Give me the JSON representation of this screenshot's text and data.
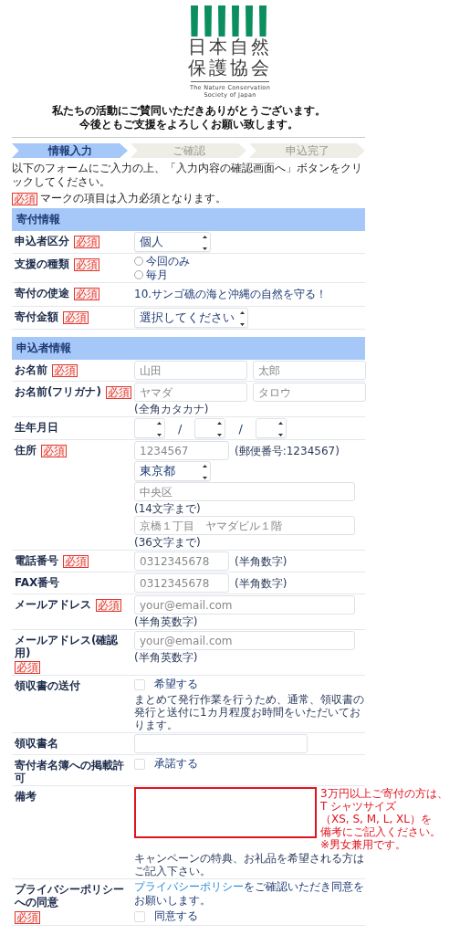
{
  "logo": {
    "title_lines": [
      "日本自然",
      "保護協会"
    ],
    "subtitle_lines": [
      "The Nature Conservation",
      "Society of Japan"
    ]
  },
  "greeting": [
    "私たちの活動にご賛同いただきありがとうございます。",
    "今後ともご支援をよろしくお願い致します。"
  ],
  "steps": [
    {
      "label": "情報入力",
      "selected": true
    },
    {
      "label": "ご確認",
      "selected": false
    },
    {
      "label": "申込完了",
      "selected": false
    }
  ],
  "instruction": "以下のフォームにご入力の上、「入力内容の確認画面へ」ボタンをクリックしてください。",
  "required_note": {
    "badge": "必須",
    "text": "マークの項目は入力必須となります。"
  },
  "sections": [
    {
      "title": "寄付情報",
      "fields": [
        {
          "label": "申込者区分",
          "required_badge": "必須",
          "lines": [
            [
              {
                "kind": "select",
                "value": "個人"
              }
            ]
          ]
        },
        {
          "label": "支援の種類",
          "required_badge": "必須",
          "lines": [
            [
              {
                "kind": "radio",
                "label": "今回のみ",
                "selected": false
              }
            ],
            [
              {
                "kind": "radio",
                "label": "毎月",
                "selected": false
              }
            ]
          ]
        },
        {
          "label": "寄付の使途",
          "required_badge": "必須",
          "lines": [
            [
              {
                "kind": "text",
                "text": "10.サンゴ礁の海と沖縄の自然を守る！"
              }
            ]
          ]
        },
        {
          "label": "寄付金額",
          "required_badge": "必須",
          "lines": [
            [
              {
                "kind": "select",
                "value": "選択してください"
              }
            ]
          ]
        }
      ]
    },
    {
      "title": "申込者情報",
      "fields": [
        {
          "label": "お名前",
          "required_badge": "必須",
          "lines": [
            [
              {
                "kind": "input",
                "placeholder": "山田"
              },
              {
                "kind": "input",
                "placeholder": "太郎"
              }
            ]
          ]
        },
        {
          "label": "お名前(フリガナ)",
          "required_badge": "必須",
          "lines": [
            [
              {
                "kind": "input",
                "placeholder": "ヤマダ"
              },
              {
                "kind": "input",
                "placeholder": "タロウ"
              }
            ],
            [
              {
                "kind": "hint",
                "text": "(全角カタカナ)"
              }
            ]
          ]
        },
        {
          "label": "生年月日",
          "lines": [
            [
              {
                "kind": "select"
              },
              {
                "kind": "separator",
                "text": "/"
              },
              {
                "kind": "select"
              },
              {
                "kind": "separator",
                "text": "/"
              },
              {
                "kind": "select"
              }
            ]
          ]
        },
        {
          "label": "住所",
          "required_badge": "必須",
          "lines": [
            [
              {
                "kind": "input",
                "placeholder": "1234567"
              },
              {
                "kind": "hint",
                "text": "(郵便番号:1234567)"
              }
            ],
            [
              {
                "kind": "select",
                "value": "東京都"
              }
            ],
            [
              {
                "kind": "input",
                "placeholder": "中央区"
              }
            ],
            [
              {
                "kind": "hint",
                "text": "(14文字まで)"
              }
            ],
            [
              {
                "kind": "input",
                "placeholder": "京橋１丁目　ヤマダビル１階"
              }
            ],
            [
              {
                "kind": "hint",
                "text": "(36文字まで)"
              }
            ]
          ]
        },
        {
          "label": "電話番号",
          "required_badge": "必須",
          "lines": [
            [
              {
                "kind": "input",
                "placeholder": "0312345678"
              },
              {
                "kind": "hint",
                "text": "(半角数字)"
              }
            ]
          ]
        },
        {
          "label": "FAX番号",
          "lines": [
            [
              {
                "kind": "input",
                "placeholder": "0312345678"
              },
              {
                "kind": "hint",
                "text": "(半角数字)"
              }
            ]
          ]
        },
        {
          "label": "メールアドレス",
          "required_badge": "必須",
          "lines": [
            [
              {
                "kind": "input",
                "placeholder": "your@email.com"
              }
            ],
            [
              {
                "kind": "hint",
                "text": "(半角英数字)"
              }
            ]
          ]
        },
        {
          "label": "メールアドレス(確認用)",
          "required_badge": "必須",
          "lines": [
            [
              {
                "kind": "input",
                "placeholder": "your@email.com"
              }
            ],
            [
              {
                "kind": "hint",
                "text": "(半角英数字)"
              }
            ]
          ]
        },
        {
          "label": "領収書の送付",
          "lines": [
            [
              {
                "kind": "checkbox",
                "label": "希望する",
                "checked": false
              }
            ],
            [
              {
                "kind": "hint",
                "text": "まとめて発行作業を行うため、通常、領収書の発行と送付に1カ月程度お時間をいただいております。"
              }
            ]
          ]
        },
        {
          "label": "領収書名",
          "lines": [
            [
              {
                "kind": "input"
              }
            ]
          ]
        },
        {
          "label": "寄付者名簿への掲載許可",
          "lines": [
            [
              {
                "kind": "checkbox",
                "label": "承諾する",
                "checked": false
              }
            ]
          ]
        },
        {
          "label": "備考",
          "side_note": [
            "3万円以上ご寄付の方は、",
            "T シャツサイズ",
            "（XS, S, M, L, XL）を",
            "備考にご記入ください。",
            "※男女兼用です。"
          ],
          "lines": [
            [
              {
                "kind": "textarea",
                "highlighted": true
              }
            ],
            [
              {
                "kind": "hint",
                "text": "キャンペーンの特典、お礼品を希望される方はご記入下さい。"
              }
            ]
          ]
        },
        {
          "label": "プライバシーポリシーへの同意",
          "required_badge": "必須",
          "lines": [
            [
              {
                "kind": "link_text",
                "link": "プライバシーポリシー",
                "text": "をご確認いただき同意をお願いします。"
              }
            ],
            [
              {
                "kind": "checkbox",
                "label": "同意する",
                "checked": false
              }
            ]
          ]
        }
      ]
    }
  ]
}
